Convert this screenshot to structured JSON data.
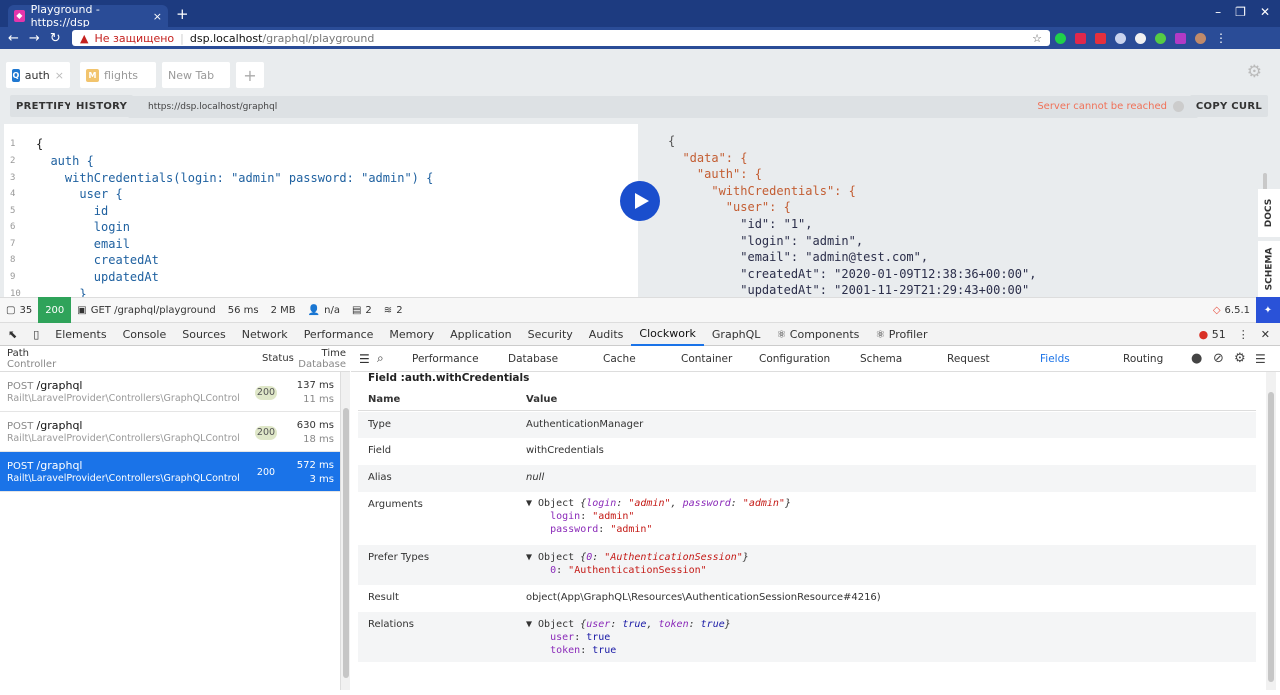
{
  "browser": {
    "tab_title": "Playground - https://dsp",
    "tab_close": "×",
    "new_tab": "+",
    "warning": "Не защищено",
    "host": "dsp.localhost",
    "path": "/graphql/playground"
  },
  "playground": {
    "tabs": [
      {
        "badge": "Q",
        "label": "auth",
        "badge_color": "#1f78d1"
      },
      {
        "badge": "M",
        "label": "flights",
        "badge_color": "#f2c46d"
      },
      {
        "badge": "",
        "label": "New Tab",
        "badge_color": ""
      }
    ],
    "prettify": "PRETTIFY",
    "history": "HISTORY",
    "endpoint": "https://dsp.localhost/graphql",
    "server_status": "Server cannot be reached",
    "copy_curl": "COPY CURL",
    "docs": "DOCS",
    "schema": "SCHEMA",
    "query_lines": [
      {
        "n": "1",
        "t": "{"
      },
      {
        "n": "2",
        "t": "  auth {"
      },
      {
        "n": "3",
        "t": "    withCredentials(login: \"admin\" password: \"admin\") {"
      },
      {
        "n": "4",
        "t": "      user {"
      },
      {
        "n": "5",
        "t": "        id"
      },
      {
        "n": "6",
        "t": "        login"
      },
      {
        "n": "7",
        "t": "        email"
      },
      {
        "n": "8",
        "t": "        createdAt"
      },
      {
        "n": "9",
        "t": "        updatedAt"
      },
      {
        "n": "10",
        "t": "      }"
      }
    ],
    "result_lines": [
      "{",
      "  \"data\": {",
      "    \"auth\": {",
      "      \"withCredentials\": {",
      "        \"user\": {",
      "          \"id\": \"1\",",
      "          \"login\": \"admin\",",
      "          \"email\": \"admin@test.com\",",
      "          \"createdAt\": \"2020-01-09T12:38:36+00:00\",",
      "          \"updatedAt\": \"2001-11-29T21:29:43+00:00\""
    ]
  },
  "debugbar": {
    "count": "35",
    "status": "200",
    "request": "GET /graphql/playground",
    "time": "56 ms",
    "memory": "2 MB",
    "user": "n/a",
    "views": "2",
    "queries": "2",
    "version": "6.5.1"
  },
  "devtools": {
    "tabs": [
      "Elements",
      "Console",
      "Sources",
      "Network",
      "Performance",
      "Memory",
      "Application",
      "Security",
      "Audits",
      "Clockwork",
      "GraphQL",
      "⚛ Components",
      "⚛ Profiler"
    ],
    "active": "Clockwork",
    "errors": "51"
  },
  "clockwork": {
    "head": {
      "path": "Path",
      "controller": "Controller",
      "status": "Status",
      "time": "Time",
      "database": "Database"
    },
    "requests": [
      {
        "method": "POST",
        "path": "/graphql",
        "controller": "Railt\\LaravelProvider\\Controllers\\GraphQLController@graphql",
        "status": "200",
        "time": "137 ms",
        "db": "11 ms"
      },
      {
        "method": "POST",
        "path": "/graphql",
        "controller": "Railt\\LaravelProvider\\Controllers\\GraphQLController@graphql",
        "status": "200",
        "time": "630 ms",
        "db": "18 ms"
      },
      {
        "method": "POST",
        "path": "/graphql",
        "controller": "Railt\\LaravelProvider\\Controllers\\GraphQLController@",
        "status": "200",
        "time": "572 ms",
        "db": "3 ms"
      }
    ],
    "panel_tabs": [
      "Performance",
      "Database",
      "Cache",
      "Container",
      "Configuration",
      "Schema",
      "Request",
      "Fields",
      "Routing"
    ],
    "active_panel": "Fields",
    "field_title": "Field :auth.withCredentials",
    "col_name": "Name",
    "col_value": "Value",
    "rows": {
      "type": {
        "k": "Type",
        "v": "AuthenticationManager"
      },
      "field": {
        "k": "Field",
        "v": "withCredentials"
      },
      "alias": {
        "k": "Alias",
        "v": "null"
      },
      "arguments": {
        "k": "Arguments"
      },
      "prefer": {
        "k": "Prefer Types"
      },
      "result": {
        "k": "Result",
        "v": "object(App\\GraphQL\\Resources\\AuthenticationSessionResource#4216)"
      },
      "relations": {
        "k": "Relations"
      }
    }
  }
}
